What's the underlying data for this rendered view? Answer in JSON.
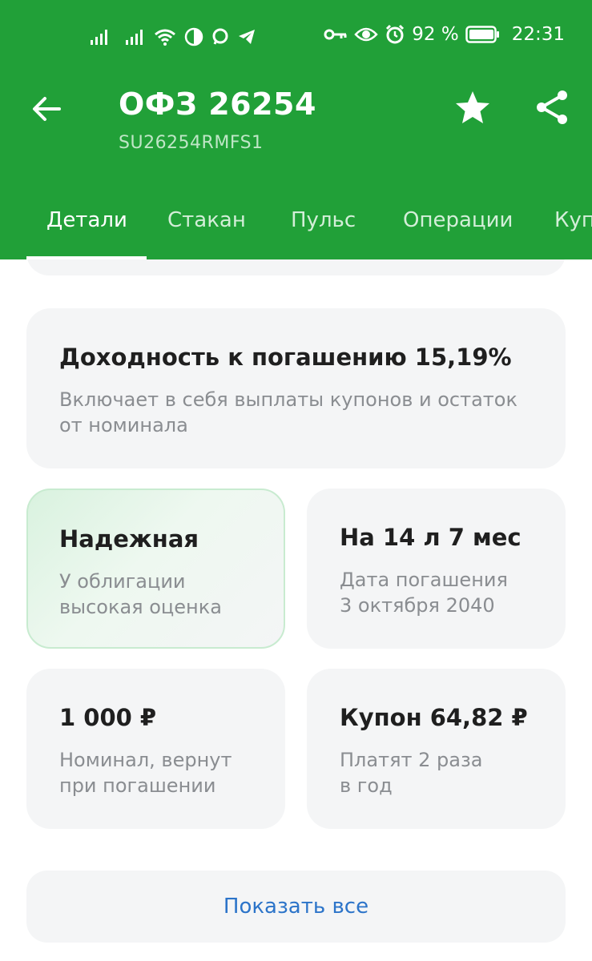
{
  "status_bar": {
    "battery": "92 %",
    "time": "22:31",
    "icons": [
      "signal-icon",
      "signal-icon",
      "wifi-icon",
      "halfmoon-icon",
      "chat-icon",
      "telegram-icon",
      "key-icon",
      "eye-icon",
      "alarm-icon",
      "battery-icon"
    ]
  },
  "header": {
    "title": "ОФЗ 26254",
    "subtitle": "SU26254RMFS1",
    "back_icon": "arrow-left-icon",
    "favorite_icon": "star-icon",
    "share_icon": "share-icon",
    "background_color": "#21a038"
  },
  "tabs": [
    {
      "label": "Детали",
      "active": true
    },
    {
      "label": "Стакан",
      "active": false
    },
    {
      "label": "Пульс",
      "active": false
    },
    {
      "label": "Операции",
      "active": false
    },
    {
      "label": "Куп",
      "active": false
    }
  ],
  "cards": {
    "yield": {
      "title": "Доходность к погашению 15,19%",
      "description": "Включает в себя выплаты купонов и остаток\nот номинала"
    },
    "reliable": {
      "title": "Надежная",
      "description": "У облигации\nвысокая оценка"
    },
    "maturity": {
      "title": "На 14 л 7 мес",
      "description": "Дата погашения\n3 октября 2040"
    },
    "nominal": {
      "title": "1 000 ₽",
      "description": "Номинал, вернут\nпри погашении"
    },
    "coupon": {
      "title": "Купон 64,82 ₽",
      "description": "Платят 2 раза\nв год"
    }
  },
  "show_all_label": "Показать все",
  "colors": {
    "accent_green": "#21a038",
    "link_blue": "#2c74c9",
    "card_bg": "#f4f5f6"
  }
}
